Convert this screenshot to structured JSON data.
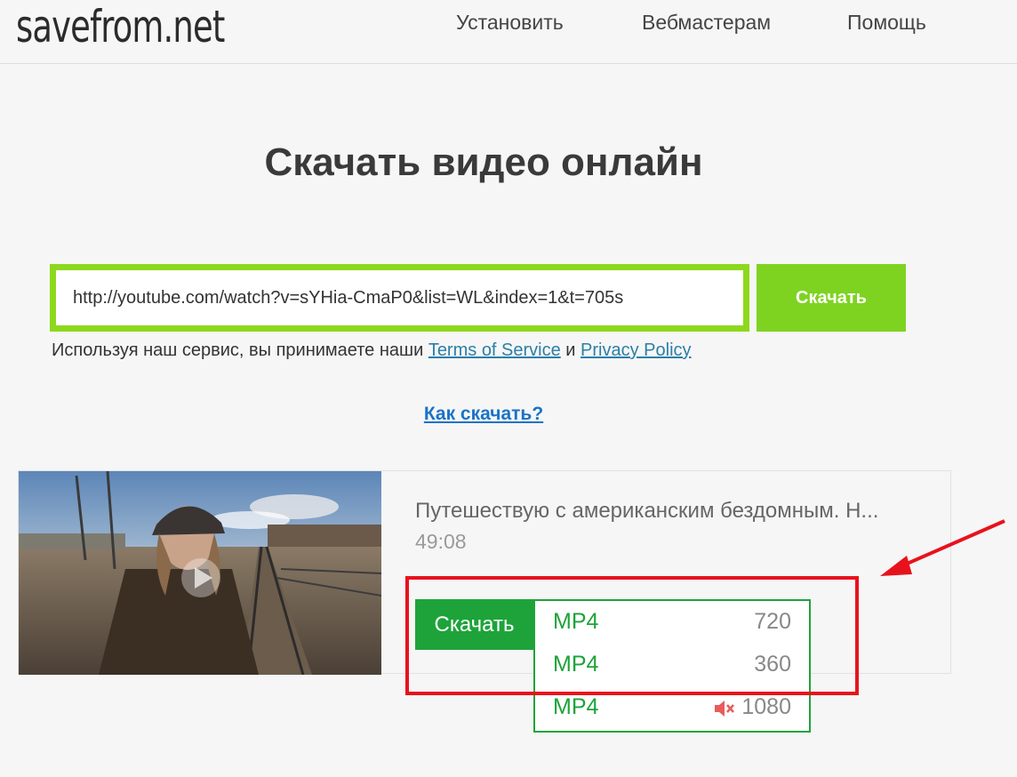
{
  "header": {
    "logo": "savefrom.net",
    "nav": [
      "Установить",
      "Вебмастерам",
      "Помощь"
    ]
  },
  "main": {
    "title": "Скачать видео онлайн",
    "search": {
      "value": "http://youtube.com/watch?v=sYHia-CmaP0&list=WL&index=1&t=705s",
      "button": "Скачать"
    },
    "terms": {
      "prefix": "Используя наш сервис, вы принимаете наши ",
      "tos": "Terms of Service",
      "and": " и ",
      "privacy": "Privacy Policy"
    },
    "howto": "Как скачать?"
  },
  "result": {
    "title": "Путешествую с американским бездомным. Н...",
    "duration": "49:08",
    "download_button": "Скачать",
    "formats": [
      {
        "format": "MP4",
        "quality": "720",
        "muted": false
      },
      {
        "format": "MP4",
        "quality": "360",
        "muted": false
      },
      {
        "format": "MP4",
        "quality": "1080",
        "muted": true
      }
    ]
  },
  "colors": {
    "accent_green": "#7ed321",
    "download_green": "#1ea33a",
    "annotation_red": "#e8121c",
    "link_blue": "#1a73c8"
  }
}
